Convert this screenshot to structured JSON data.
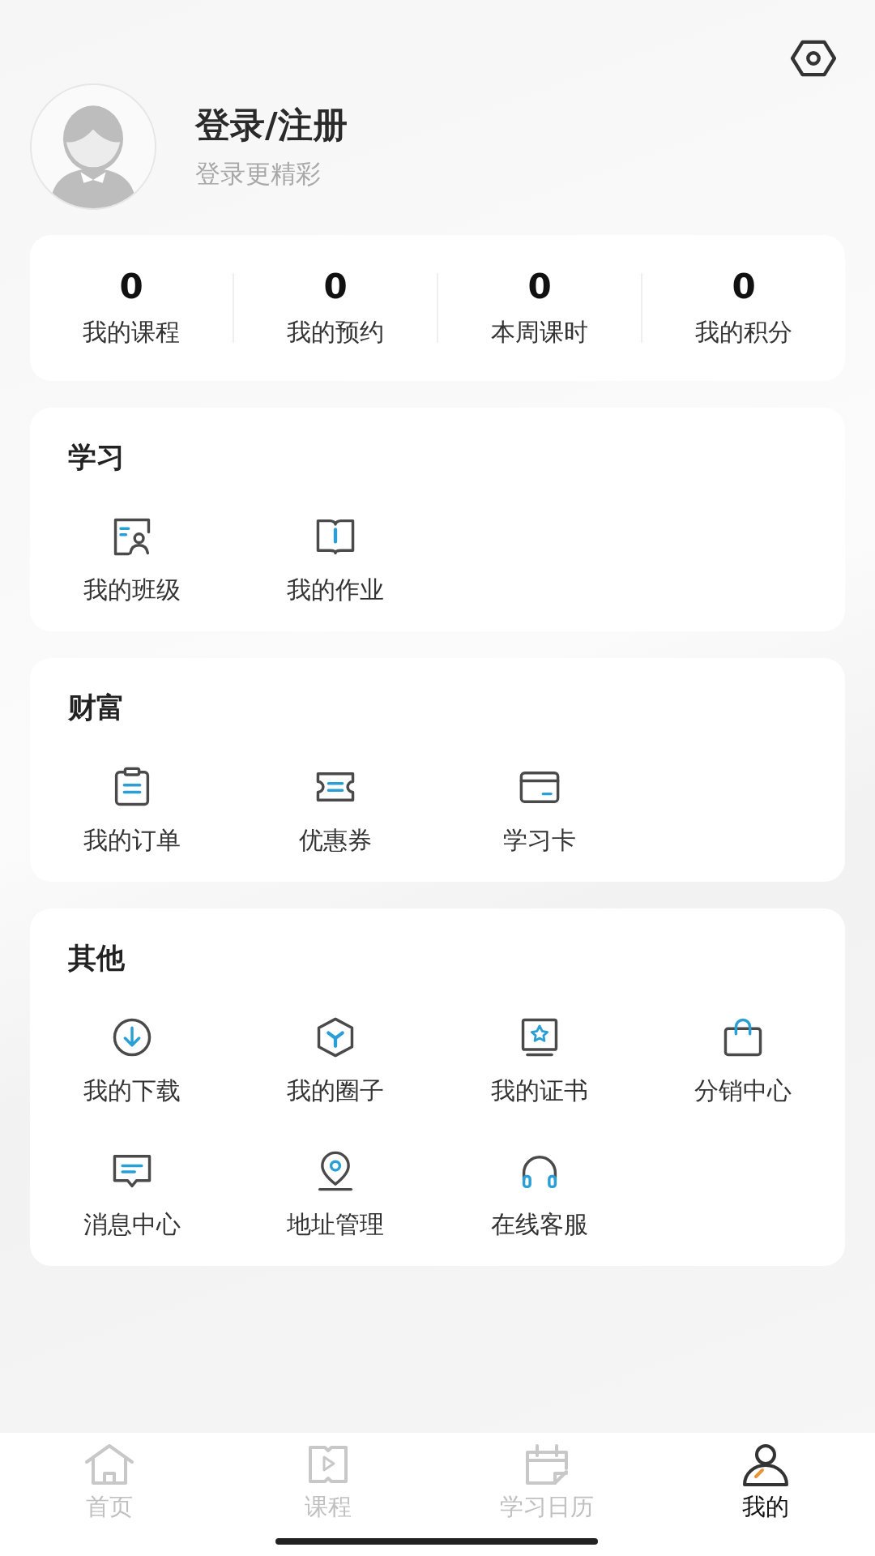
{
  "profile": {
    "title": "登录/注册",
    "subtitle": "登录更精彩"
  },
  "stats": [
    {
      "value": "0",
      "label": "我的课程"
    },
    {
      "value": "0",
      "label": "我的预约"
    },
    {
      "value": "0",
      "label": "本周课时"
    },
    {
      "value": "0",
      "label": "我的积分"
    }
  ],
  "sections": [
    {
      "title": "学习",
      "items": [
        "我的班级",
        "我的作业"
      ]
    },
    {
      "title": "财富",
      "items": [
        "我的订单",
        "优惠券",
        "学习卡"
      ]
    },
    {
      "title": "其他",
      "items": [
        "我的下载",
        "我的圈子",
        "我的证书",
        "分销中心",
        "消息中心",
        "地址管理",
        "在线客服"
      ]
    }
  ],
  "tab_bar": [
    {
      "label": "首页",
      "selected": false
    },
    {
      "label": "课程",
      "selected": false
    },
    {
      "label": "学习日历",
      "selected": false
    },
    {
      "label": "我的",
      "selected": true
    }
  ]
}
